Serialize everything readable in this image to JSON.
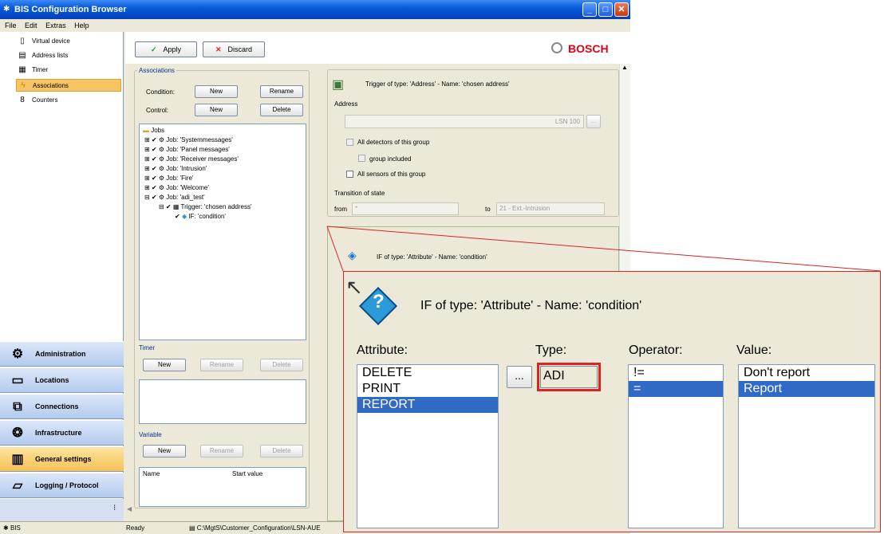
{
  "window": {
    "title": "BIS Configuration Browser"
  },
  "menu": [
    "File",
    "Edit",
    "Extras",
    "Help"
  ],
  "tree_nav": [
    {
      "label": "Virtual device",
      "icon": "device-icon"
    },
    {
      "label": "Address lists",
      "icon": "list-icon"
    },
    {
      "label": "Timer",
      "icon": "timer-icon"
    },
    {
      "label": "Associations",
      "icon": "lightning-icon"
    },
    {
      "label": "Counters",
      "icon": "counter-icon"
    }
  ],
  "nav_buttons": [
    "Administration",
    "Locations",
    "Connections",
    "Infrastructure",
    "General settings",
    "Logging / Protocol"
  ],
  "toolbar": {
    "apply": "Apply",
    "discard": "Discard",
    "brand": "BOSCH"
  },
  "associations": {
    "title": "Associations",
    "condition_label": "Condition:",
    "control_label": "Control:",
    "new": "New",
    "rename": "Rename",
    "delete": "Delete"
  },
  "jobs_tree": {
    "root": "Jobs",
    "items": [
      "Job: 'Systemmessages'",
      "Job: 'Panel messages'",
      "Job: 'Receiver messages'",
      "Job: 'Intrusion'",
      "Job: 'Fire'",
      "Job: 'Welcome'",
      "Job: 'adi_test'"
    ],
    "trigger": "Trigger: 'chosen address'",
    "if": "IF: 'condition'"
  },
  "timer": {
    "title": "Timer",
    "new": "New",
    "rename": "Rename",
    "delete": "Delete"
  },
  "variable": {
    "title": "Variable",
    "new": "New",
    "rename": "Rename",
    "delete": "Delete",
    "col_name": "Name",
    "col_start": "Start value"
  },
  "trigger_panel": {
    "header": "Trigger of type: 'Address' - Name: 'chosen address'",
    "address_label": "Address",
    "address_value": "LSN 100",
    "browse": "...",
    "cb_all_detectors": "All detectors of this group",
    "cb_group_included": "group included",
    "cb_all_sensors": "All sensors of this group",
    "transition_label": "Transition of state",
    "from_label": "from",
    "from_value": "*",
    "to_label": "to",
    "to_value": "21 - Ext.-Intrusion"
  },
  "if_panel": {
    "header": "IF of type: 'Attribute' - Name: 'condition'"
  },
  "status": {
    "app": "BIS",
    "state": "Ready",
    "path": "C:\\MgtS\\Customer_Configuration\\LSN-AUE"
  },
  "zoom": {
    "header": "IF of type: 'Attribute'  -  Name: 'condition'",
    "attribute_label": "Attribute:",
    "type_label": "Type:",
    "operator_label": "Operator:",
    "value_label": "Value:",
    "attributes": [
      "DELETE",
      "PRINT",
      "REPORT"
    ],
    "attribute_selected": "REPORT",
    "type_value": "ADI",
    "browse": "...",
    "operators": [
      "!=",
      "="
    ],
    "operator_selected": "=",
    "values": [
      "Don't report",
      "Report"
    ],
    "value_selected": "Report"
  },
  "colors": {
    "highlight": "#316ac5",
    "callout": "#d22222",
    "brand": "#e20015"
  }
}
